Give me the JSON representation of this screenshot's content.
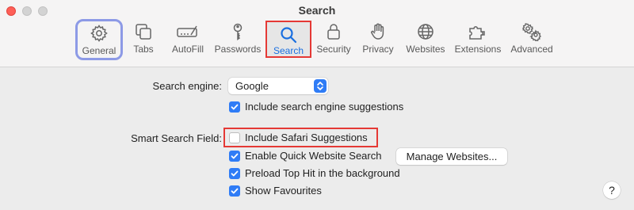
{
  "window": {
    "title": "Search"
  },
  "toolbar": {
    "tabs": [
      {
        "label": "General",
        "icon": "gear-icon"
      },
      {
        "label": "Tabs",
        "icon": "tabs-icon"
      },
      {
        "label": "AutoFill",
        "icon": "autofill-icon"
      },
      {
        "label": "Passwords",
        "icon": "key-icon"
      },
      {
        "label": "Search",
        "icon": "magnifier-icon"
      },
      {
        "label": "Security",
        "icon": "lock-icon"
      },
      {
        "label": "Privacy",
        "icon": "hand-icon"
      },
      {
        "label": "Websites",
        "icon": "globe-icon"
      },
      {
        "label": "Extensions",
        "icon": "puzzle-icon"
      },
      {
        "label": "Advanced",
        "icon": "gears-icon"
      }
    ],
    "selected": "Search"
  },
  "search_engine": {
    "label": "Search engine:",
    "value": "Google",
    "include_suggestions": {
      "label": "Include search engine suggestions",
      "checked": true
    }
  },
  "smart_search_field": {
    "label": "Smart Search Field:",
    "options": [
      {
        "label": "Include Safari Suggestions",
        "checked": false
      },
      {
        "label": "Enable Quick Website Search",
        "checked": true
      },
      {
        "label": "Preload Top Hit in the background",
        "checked": true
      },
      {
        "label": "Show Favourites",
        "checked": true
      }
    ],
    "manage_button": "Manage Websites..."
  },
  "help": "?",
  "colors": {
    "accent": "#2f7cf6",
    "highlight_red": "#e53935",
    "general_outline": "#8d9ae6"
  }
}
